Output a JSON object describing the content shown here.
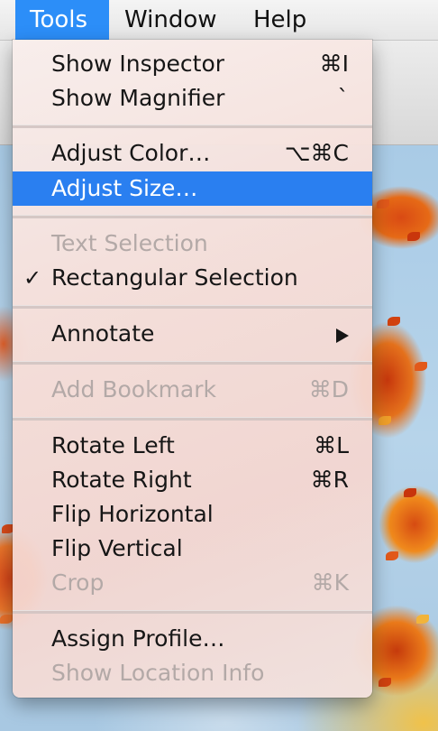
{
  "menubar": {
    "items": [
      {
        "label": "Tools"
      },
      {
        "label": "Window"
      },
      {
        "label": "Help"
      }
    ]
  },
  "menu": {
    "items": [
      {
        "label": "Show Inspector",
        "shortcut": "⌘I"
      },
      {
        "label": "Show Magnifier",
        "shortcut": "`"
      },
      {
        "label": "Adjust Color…",
        "shortcut": "⌥⌘C"
      },
      {
        "label": "Adjust Size…",
        "shortcut": ""
      },
      {
        "label": "Text Selection",
        "shortcut": ""
      },
      {
        "label": "Rectangular Selection",
        "shortcut": "",
        "check": "✓"
      },
      {
        "label": "Annotate",
        "shortcut": ""
      },
      {
        "label": "Add Bookmark",
        "shortcut": "⌘D"
      },
      {
        "label": "Rotate Left",
        "shortcut": "⌘L"
      },
      {
        "label": "Rotate Right",
        "shortcut": "⌘R"
      },
      {
        "label": "Flip Horizontal",
        "shortcut": ""
      },
      {
        "label": "Flip Vertical",
        "shortcut": ""
      },
      {
        "label": "Crop",
        "shortcut": "⌘K"
      },
      {
        "label": "Assign Profile…",
        "shortcut": ""
      },
      {
        "label": "Show Location Info",
        "shortcut": ""
      }
    ]
  },
  "colors": {
    "highlight": "#2a7ff0",
    "menubar_active": "#2c8ef8",
    "disabled_text": "#b3a9a7"
  },
  "icons": {
    "submenu_arrow": "chevron-right-icon",
    "checkmark": "checkmark-icon"
  }
}
